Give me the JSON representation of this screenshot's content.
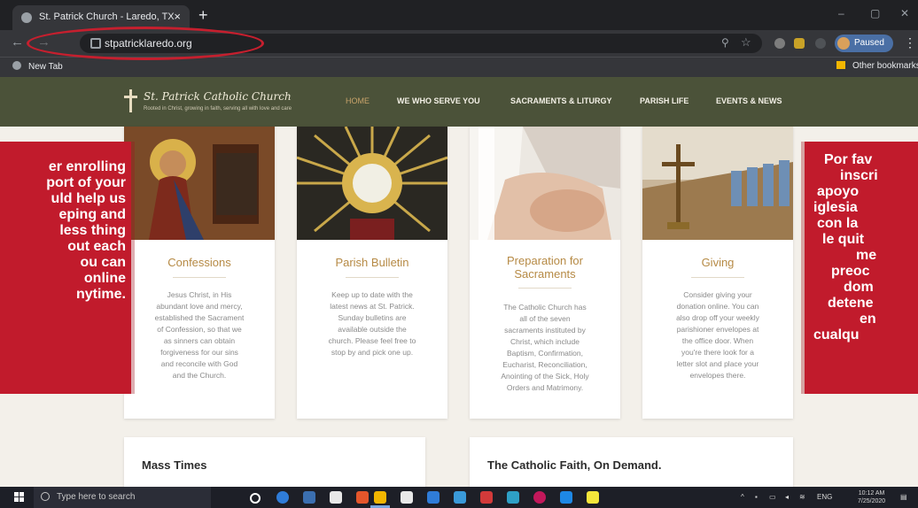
{
  "browser": {
    "tab_title": "St. Patrick Church - Laredo, TX",
    "tab_close": "×",
    "new_tab": "+",
    "url": "stpatricklaredo.org",
    "zoom_icon": "zoom-icon",
    "profile_label": "Paused",
    "menu": "⋮",
    "back": "←",
    "forward": "→",
    "minimize": "–",
    "maximize": "▢",
    "close": "✕",
    "bookmark_newtab": "New Tab",
    "bookmark_other": "Other bookmarks",
    "accent": "#c61f2e"
  },
  "site": {
    "name": "St. Patrick Catholic Church",
    "tagline": "Rooted in Christ, growing in faith, serving all with love and care",
    "nav": [
      "HOME",
      "WE WHO SERVE YOU",
      "SACRAMENTS & LITURGY",
      "PARISH LIFE",
      "EVENTS & NEWS"
    ],
    "header_color": "#4b5239",
    "accent_gold": "#b68a45"
  },
  "cards": [
    {
      "title": [
        "Confessions"
      ],
      "body": [
        "Jesus Christ, in His",
        "abundant love and mercy,",
        "established the Sacrament",
        "of Confession, so that we",
        "as sinners can obtain",
        "forgiveness for our sins",
        "and reconcile with God",
        "and the Church."
      ]
    },
    {
      "title": [
        "Parish Bulletin"
      ],
      "body": [
        "Keep up to date with the",
        "latest news at St. Patrick.",
        "Sunday bulletins are",
        "available outside the",
        "church. Please feel free to",
        "stop by and pick one up."
      ]
    },
    {
      "title": [
        "Preparation for",
        "Sacraments"
      ],
      "body": [
        "The Catholic Church has",
        "all of the seven",
        "sacraments instituted by",
        "Christ, which include",
        "Baptism, Confirmation,",
        "Eucharist, Reconciliation,",
        "Anointing of the Sick, Holy",
        "Orders and Matrimony."
      ]
    },
    {
      "title": [
        "Giving"
      ],
      "body": [
        "Consider giving your",
        "donation online. You can",
        "also drop off your weekly",
        "parishioner envelopes at",
        "the office door. When",
        "you're there look for a",
        "letter slot and place your",
        "envelopes there."
      ]
    }
  ],
  "lower": {
    "mass_times": "Mass Times",
    "faith_on_demand": "The Catholic Faith, On Demand."
  },
  "overlay_left": [
    "er enrolling",
    "port of your",
    "uld help us",
    "eping and",
    "less thing",
    "out each",
    "ou can",
    "online",
    "nytime."
  ],
  "overlay_right": [
    "Por fav",
    "inscri",
    "apoyo",
    "iglesia",
    "con la",
    "le quit",
    "me",
    "preoc",
    "dom",
    "detene",
    "en",
    "cualqu"
  ],
  "taskbar": {
    "search_placeholder": "Type here to search",
    "lang": "ENG",
    "time": "10:12 AM",
    "date": "7/25/2020"
  }
}
